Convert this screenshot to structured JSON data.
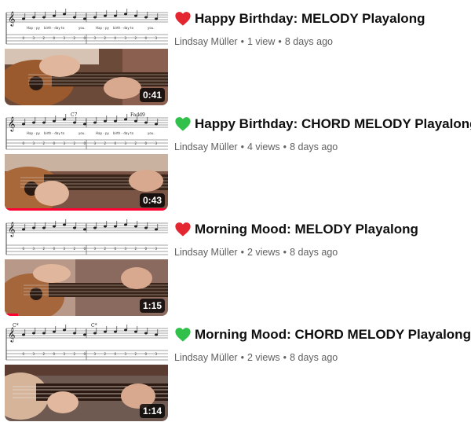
{
  "videos": [
    {
      "title": "Happy Birthday: MELODY Playalong",
      "heart_icon": "red-heart-icon",
      "heart_color": "#e3262f",
      "channel": "Lindsay Müller",
      "views": "1 view",
      "age": "8 days ago",
      "duration": "0:41",
      "watched_fraction": 0,
      "sheet_lyrics": [
        "Hap - py",
        "birth - day",
        "to",
        "you.",
        "Hap - py",
        "birth - day",
        "to",
        "you."
      ],
      "sheet_chords": []
    },
    {
      "title": "Happy Birthday: CHORD MELODY Playalong",
      "heart_icon": "green-heart-icon",
      "heart_color": "#31c04a",
      "channel": "Lindsay Müller",
      "views": "4 views",
      "age": "8 days ago",
      "duration": "0:43",
      "watched_fraction": 1.0,
      "sheet_lyrics": [
        "Hap - py",
        "birth - day",
        "to",
        "you.",
        "Hap - py",
        "birth - day",
        "to",
        "you."
      ],
      "sheet_chords": [
        "C7",
        "Fadd9"
      ]
    },
    {
      "title": "Morning Mood: MELODY Playalong",
      "heart_icon": "red-heart-icon",
      "heart_color": "#e3262f",
      "channel": "Lindsay Müller",
      "views": "2 views",
      "age": "8 days ago",
      "duration": "1:15",
      "watched_fraction": 0.08,
      "sheet_lyrics": [],
      "sheet_chords": []
    },
    {
      "title": "Morning Mood: CHORD MELODY Playalong",
      "heart_icon": "green-heart-icon",
      "heart_color": "#31c04a",
      "channel": "Lindsay Müller",
      "views": "2 views",
      "age": "8 days ago",
      "duration": "1:14",
      "watched_fraction": 0,
      "sheet_lyrics": [],
      "sheet_chords": [
        "C*",
        "C*"
      ]
    }
  ],
  "meta_separator": "•",
  "accent_color": "#ff0033"
}
